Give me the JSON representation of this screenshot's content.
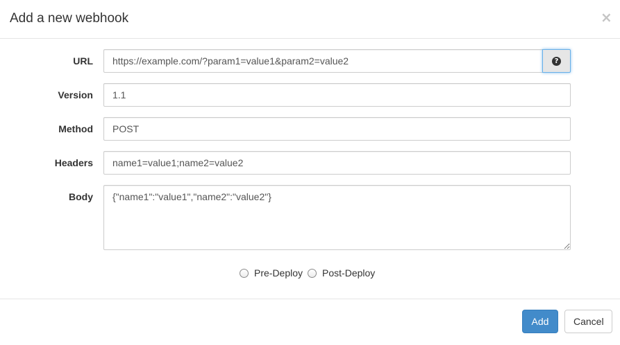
{
  "modal": {
    "title": "Add a new webhook",
    "close_label": "×"
  },
  "form": {
    "url": {
      "label": "URL",
      "value": "https://example.com/?param1=value1&param2=value2",
      "help_icon": "question-circle-icon",
      "help_glyph": "?"
    },
    "version": {
      "label": "Version",
      "value": "1.1"
    },
    "method": {
      "label": "Method",
      "value": "POST"
    },
    "headers": {
      "label": "Headers",
      "value": "name1=value1;name2=value2"
    },
    "body": {
      "label": "Body",
      "value": "{\"name1\":\"value1\",\"name2\":\"value2\"}"
    },
    "trigger": {
      "options": [
        {
          "label": "Pre-Deploy",
          "selected": false
        },
        {
          "label": "Post-Deploy",
          "selected": false
        }
      ]
    }
  },
  "footer": {
    "add_label": "Add",
    "cancel_label": "Cancel"
  },
  "colors": {
    "primary": "#428bca",
    "focus_border": "#66afe9"
  }
}
